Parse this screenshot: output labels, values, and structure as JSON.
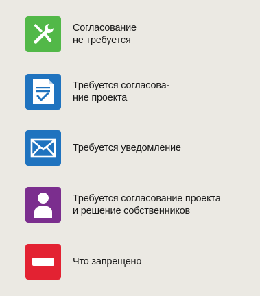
{
  "items": [
    {
      "icon": "wrench-icon",
      "color": "#52b848",
      "label": "Согласование\nне требуется"
    },
    {
      "icon": "document-check-icon",
      "color": "#1f73bf",
      "label": "Требуется согласова-\nние проекта"
    },
    {
      "icon": "envelope-icon",
      "color": "#1f73bf",
      "label": "Требуется уведомление"
    },
    {
      "icon": "person-icon",
      "color": "#7b2e8e",
      "label": "Требуется согласование проекта\nи решение собственников"
    },
    {
      "icon": "minus-icon",
      "color": "#e32232",
      "label": "Что запрещено"
    }
  ]
}
